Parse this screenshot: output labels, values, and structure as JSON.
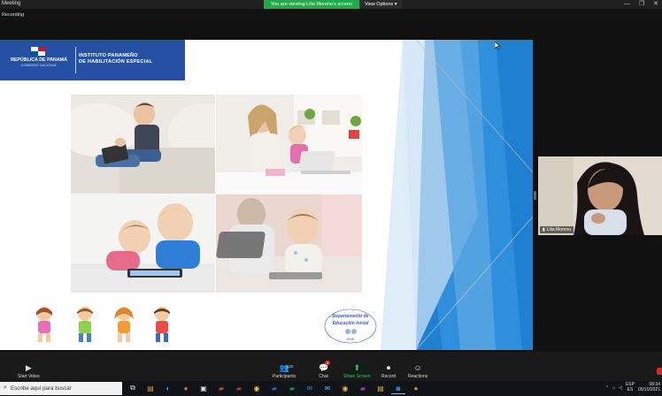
{
  "window": {
    "title": "Meeting"
  },
  "share_banner": {
    "message": "You are viewing Lilia Moreno's screen",
    "options_label": "View Options"
  },
  "recording": {
    "label": "Recording"
  },
  "slide": {
    "logo": {
      "country": "REPÚBLICA DE PANAMÁ",
      "government": "GOBIERNO NACIONAL",
      "institute_line1": "INSTITUTO PANAMEÑO",
      "institute_line2": "DE HABILITACIÓN ESPECIAL"
    },
    "dept_logo": {
      "line1": "Departamento de",
      "line2": "Educación Inicial",
      "line3": "IPHE"
    },
    "colors": {
      "brand_blue": "#2550a4",
      "accent_blue": "#2f8fdc"
    }
  },
  "participant_video": {
    "name": "Lilia Moreno"
  },
  "toolbar": {
    "start_video_label": "Start Video",
    "participants_label": "Participants",
    "participants_count": "120",
    "chat_label": "Chat",
    "chat_badge": "3",
    "share_label": "Share Screen",
    "record_label": "Record",
    "reactions_label": "Reactions",
    "share_color": "#23d160"
  },
  "taskbar": {
    "search_placeholder": "Escribe aquí para buscar",
    "language_top": "ESP",
    "language_bottom": "ES",
    "time": "08:34",
    "date": "05/10/2021"
  }
}
